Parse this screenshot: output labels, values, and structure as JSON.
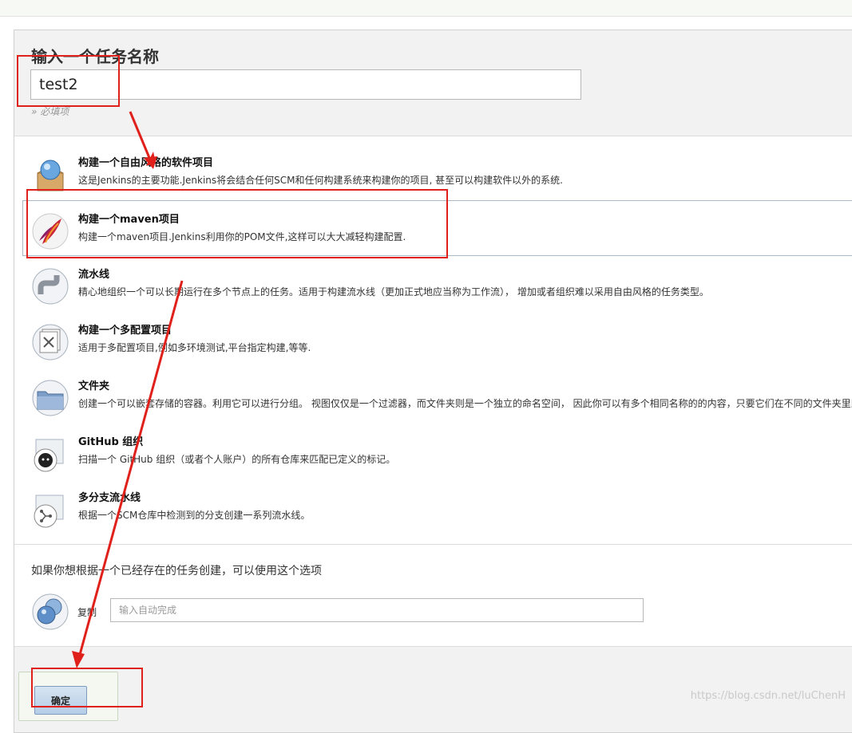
{
  "form": {
    "title": "输入一个任务名称",
    "name_value": "test2",
    "required_hint": "» 必填项"
  },
  "items": [
    {
      "icon": "freestyle-project-icon",
      "title": "构建一个自由风格的软件项目",
      "desc": "这是Jenkins的主要功能.Jenkins将会结合任何SCM和任何构建系统来构建你的项目, 甚至可以构建软件以外的系统."
    },
    {
      "icon": "maven-feather-icon",
      "title": "构建一个maven项目",
      "desc": "构建一个maven项目.Jenkins利用你的POM文件,这样可以大大减轻构建配置."
    },
    {
      "icon": "pipeline-icon",
      "title": "流水线",
      "desc": "精心地组织一个可以长期运行在多个节点上的任务。适用于构建流水线（更加正式地应当称为工作流）， 增加或者组织难以采用自由风格的任务类型。"
    },
    {
      "icon": "multi-config-project-icon",
      "title": "构建一个多配置项目",
      "desc": "适用于多配置项目,例如多环境测试,平台指定构建,等等."
    },
    {
      "icon": "folder-icon",
      "title": "文件夹",
      "desc": "创建一个可以嵌套存储的容器。利用它可以进行分组。 视图仅仅是一个过滤器，而文件夹则是一个独立的命名空间， 因此你可以有多个相同名称的的内容，只要它们在不同的文件夹里即可。"
    },
    {
      "icon": "github-organization-icon",
      "title": "GitHub 组织",
      "desc": "扫描一个 GitHub 组织（或者个人账户）的所有仓库来匹配已定义的标记。"
    },
    {
      "icon": "multibranch-pipeline-icon",
      "title": "多分支流水线",
      "desc": "根据一个SCM仓库中检测到的分支创建一系列流水线。"
    }
  ],
  "copy": {
    "label": "如果你想根据一个已经存在的任务创建，可以使用这个选项",
    "text": "复制",
    "placeholder": "输入自动完成"
  },
  "ok_button": "确定",
  "watermark": "https://blog.csdn.net/luChenH",
  "colors": {
    "annotation": "#e0201b",
    "selected_border": "#aab9c8"
  }
}
